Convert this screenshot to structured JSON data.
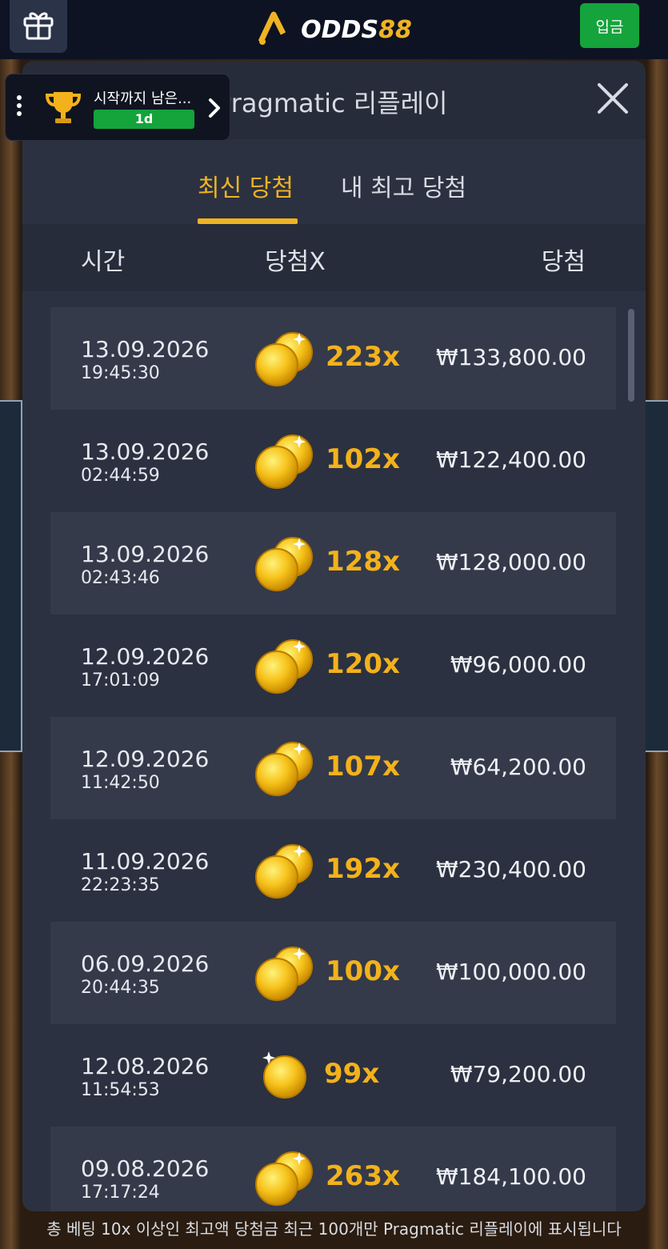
{
  "topbar": {
    "brand": "ODDS",
    "brand_num": "88",
    "deposit_label": "입금",
    "icons": [
      "gift-icon",
      "brand-logo-icon"
    ]
  },
  "tournament": {
    "label": "시작까지 남은...",
    "badge": "1d",
    "icons": [
      "more-icon",
      "trophy-icon",
      "chevron-right-icon"
    ]
  },
  "modal": {
    "title": "Pragmatic 리플레이",
    "tabs": [
      {
        "label": "최신 당첨",
        "active": true
      },
      {
        "label": "내 최고 당첨",
        "active": false
      }
    ],
    "columns": {
      "time": "시간",
      "multiplier": "당첨X",
      "win": "당첨"
    },
    "rows": [
      {
        "date": "13.09.2026",
        "time": "19:45:30",
        "multiplier": "223x",
        "amount": "₩133,800.00",
        "coins": 2
      },
      {
        "date": "13.09.2026",
        "time": "02:44:59",
        "multiplier": "102x",
        "amount": "₩122,400.00",
        "coins": 2
      },
      {
        "date": "13.09.2026",
        "time": "02:43:46",
        "multiplier": "128x",
        "amount": "₩128,000.00",
        "coins": 2
      },
      {
        "date": "12.09.2026",
        "time": "17:01:09",
        "multiplier": "120x",
        "amount": "₩96,000.00",
        "coins": 2
      },
      {
        "date": "12.09.2026",
        "time": "11:42:50",
        "multiplier": "107x",
        "amount": "₩64,200.00",
        "coins": 2
      },
      {
        "date": "11.09.2026",
        "time": "22:23:35",
        "multiplier": "192x",
        "amount": "₩230,400.00",
        "coins": 2
      },
      {
        "date": "06.09.2026",
        "time": "20:44:35",
        "multiplier": "100x",
        "amount": "₩100,000.00",
        "coins": 2
      },
      {
        "date": "12.08.2026",
        "time": "11:54:53",
        "multiplier": "99x",
        "amount": "₩79,200.00",
        "coins": 1
      },
      {
        "date": "09.08.2026",
        "time": "17:17:24",
        "multiplier": "263x",
        "amount": "₩184,100.00",
        "coins": 2
      }
    ],
    "footer": "총 베팅 10x 이상인 최고액 당첨금 최근 100개만 Pragmatic 리플레이에 표시됩니다"
  },
  "colors": {
    "accent": "#f0b323",
    "deposit": "#15a33c",
    "modal_bg": "#2b3140"
  }
}
